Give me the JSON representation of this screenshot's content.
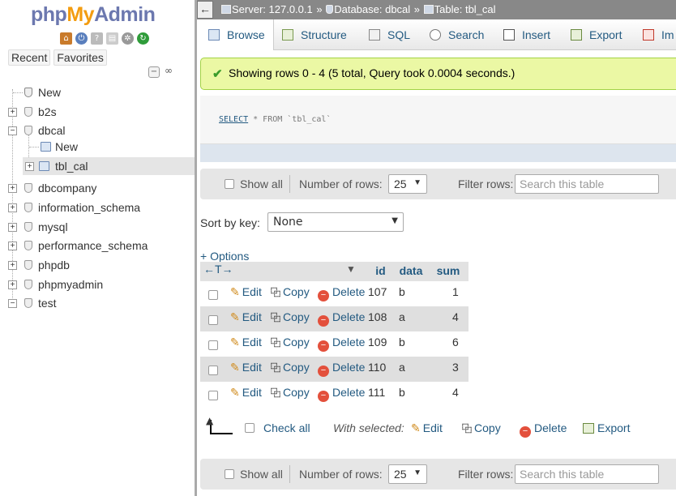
{
  "logo": {
    "php": "php",
    "my": "My",
    "admin": "Admin"
  },
  "nav": {
    "tabs": [
      "Recent",
      "Favorites"
    ],
    "tree": [
      {
        "label": "New"
      },
      {
        "label": "b2s"
      },
      {
        "label": "dbcal"
      },
      {
        "label": "New"
      },
      {
        "label": "tbl_cal"
      },
      {
        "label": "dbcompany"
      },
      {
        "label": "information_schema"
      },
      {
        "label": "mysql"
      },
      {
        "label": "performance_schema"
      },
      {
        "label": "phpdb"
      },
      {
        "label": "phpmyadmin"
      },
      {
        "label": "test"
      }
    ]
  },
  "breadcrumb": {
    "server": "Server: 127.0.0.1",
    "sep1": "»",
    "database": "Database: dbcal",
    "sep2": "»",
    "table": "Table: tbl_cal"
  },
  "tabs": [
    "Browse",
    "Structure",
    "SQL",
    "Search",
    "Insert",
    "Export",
    "Im"
  ],
  "message": "Showing rows 0 - 4 (5 total, Query took 0.0004 seconds.)",
  "sql": {
    "select": "SELECT",
    "rest": " * FROM `tbl_cal`"
  },
  "navbar": {
    "show_all": "Show all",
    "num_rows_label": "Number of rows:",
    "num_rows_value": "25",
    "filter_label": "Filter rows:",
    "filter_placeholder": "Search this table"
  },
  "sort": {
    "label": "Sort by key:",
    "value": "None"
  },
  "options_link": "+ Options",
  "table": {
    "columns": [
      "id",
      "data",
      "sum"
    ],
    "actions": {
      "edit": "Edit",
      "copy": "Copy",
      "delete": "Delete"
    },
    "rows": [
      {
        "id": "107",
        "data": "b",
        "sum": "1"
      },
      {
        "id": "108",
        "data": "a",
        "sum": "4"
      },
      {
        "id": "109",
        "data": "b",
        "sum": "6"
      },
      {
        "id": "110",
        "data": "a",
        "sum": "3"
      },
      {
        "id": "111",
        "data": "b",
        "sum": "4"
      }
    ]
  },
  "bulk": {
    "check_all": "Check all",
    "with_selected": "With selected:",
    "edit": "Edit",
    "copy": "Copy",
    "delete": "Delete",
    "export": "Export"
  },
  "colors": {
    "link": "#235a81",
    "success_bg": "#ebf8a4",
    "topbar": "#888888"
  }
}
